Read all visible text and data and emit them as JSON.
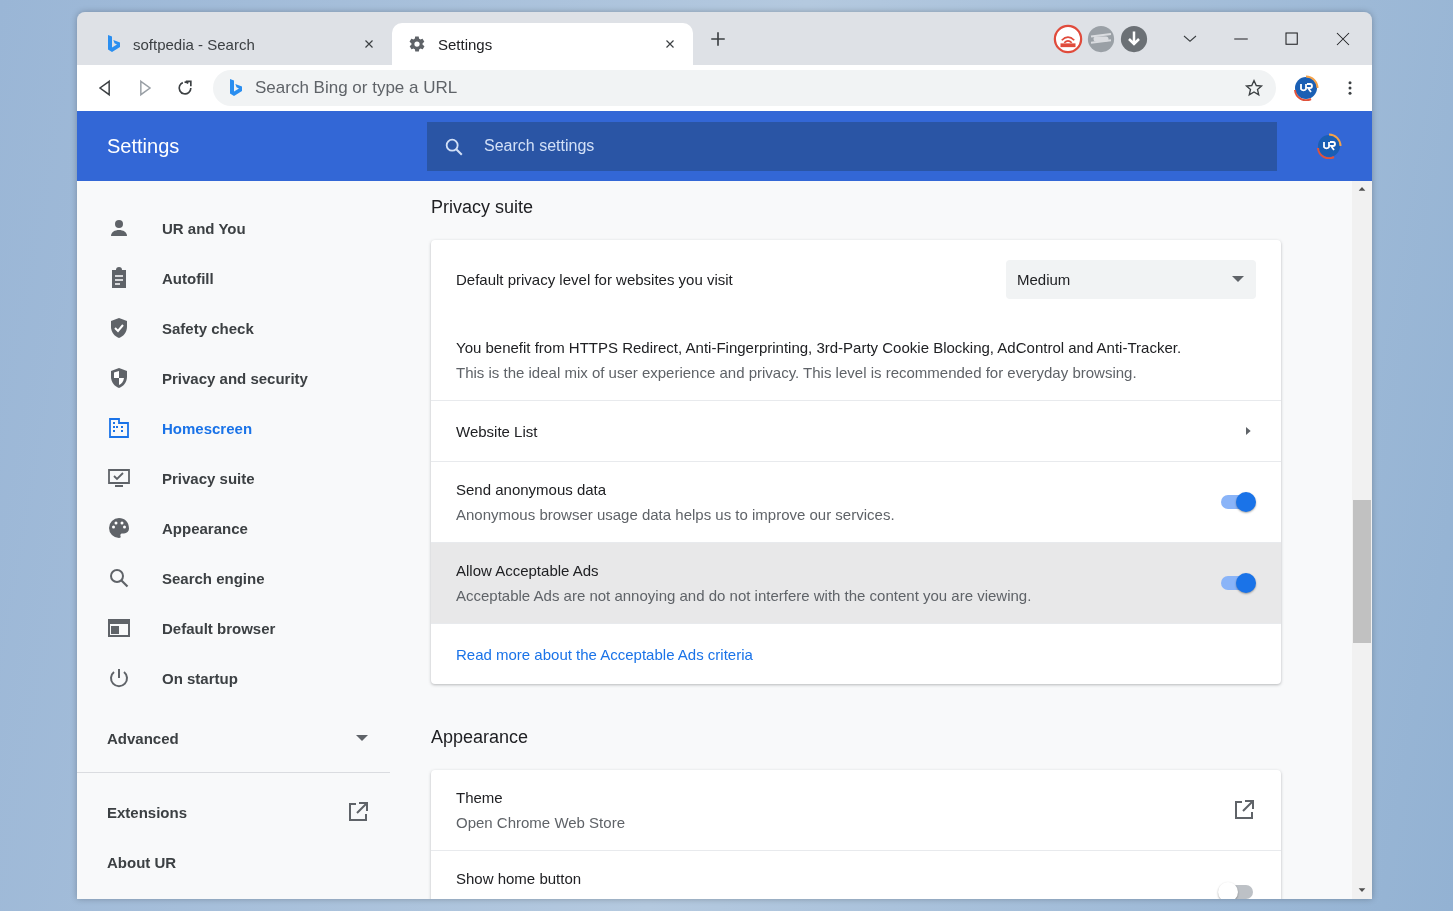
{
  "tabs": [
    {
      "title": "softpedia - Search",
      "selected": false
    },
    {
      "title": "Settings",
      "selected": true
    }
  ],
  "address_bar": {
    "placeholder": "Search Bing or type a URL"
  },
  "header": {
    "title": "Settings",
    "search": {
      "placeholder": "Search settings"
    }
  },
  "sidebar": {
    "items": [
      {
        "label": "UR and You",
        "selected": false
      },
      {
        "label": "Autofill",
        "selected": false
      },
      {
        "label": "Safety check",
        "selected": false
      },
      {
        "label": "Privacy and security",
        "selected": false
      },
      {
        "label": "Homescreen",
        "selected": true
      },
      {
        "label": "Privacy suite",
        "selected": false
      },
      {
        "label": "Appearance",
        "selected": false
      },
      {
        "label": "Search engine",
        "selected": false
      },
      {
        "label": "Default browser",
        "selected": false
      },
      {
        "label": "On startup",
        "selected": false
      }
    ],
    "advanced": {
      "label": "Advanced",
      "expanded": false
    },
    "links": [
      {
        "label": "Extensions",
        "kind": "external"
      },
      {
        "label": "About UR",
        "kind": "plain"
      }
    ]
  },
  "sections": [
    {
      "title": "Privacy suite",
      "rows": [
        {
          "kind": "dropdown",
          "label": "Default privacy level for websites you visit",
          "value": "Medium"
        },
        {
          "kind": "text",
          "lines": [
            "You benefit from HTTPS Redirect, Anti-Fingerprinting, 3rd-Party Cookie Blocking, AdControl and Anti-Tracker.",
            "This is the ideal mix of user experience and privacy. This level is recommended for everyday browsing."
          ]
        },
        {
          "kind": "submenu",
          "label": "Website List"
        },
        {
          "kind": "toggle",
          "label": "Send anonymous data",
          "description": "Anonymous browser usage data helps us to improve our services.",
          "on": true,
          "highlighted": false
        },
        {
          "kind": "toggle",
          "label": "Allow Acceptable Ads",
          "description": "Acceptable Ads are not annoying and do not interfere with the content you are viewing.",
          "on": true,
          "highlighted": true
        },
        {
          "kind": "link",
          "label": "Read more about the Acceptable Ads criteria"
        }
      ]
    },
    {
      "title": "Appearance",
      "rows": [
        {
          "kind": "external",
          "label": "Theme",
          "description": "Open Chrome Web Store"
        },
        {
          "kind": "toggle",
          "label": "Show home button",
          "on": false,
          "highlighted": false
        }
      ]
    }
  ]
}
